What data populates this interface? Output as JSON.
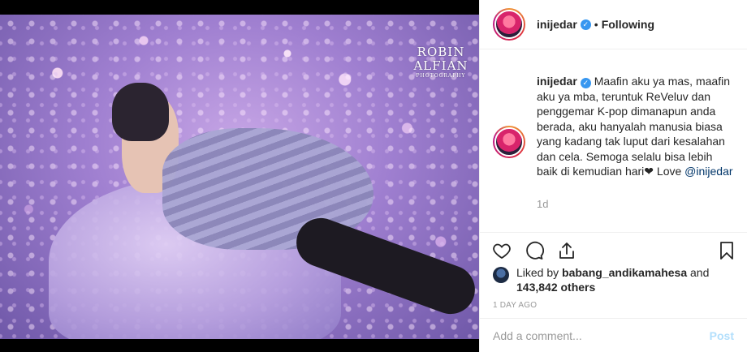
{
  "media": {
    "watermark_line1": "ROBIN",
    "watermark_line2": "ALFIAN",
    "watermark_line3": "PHOTOGRAPHY"
  },
  "header": {
    "username": "inijedar",
    "separator": "•",
    "follow_status": "Following"
  },
  "caption": {
    "username": "inijedar",
    "text": "Maafin aku ya mas, maafin aku ya mba, teruntuk ReVeluv dan penggemar K-pop dimanapun anda berada, aku hanyalah manusia biasa yang kadang tak luput dari kesalahan dan cela. Semoga selalu bisa lebih baik di kemudian hari❤ Love",
    "mention": "@inijedar",
    "time": "1d"
  },
  "actions": {
    "like_icon": "heart-icon",
    "comment_icon": "comment-icon",
    "share_icon": "share-icon",
    "save_icon": "bookmark-icon"
  },
  "likes": {
    "prefix": "Liked by",
    "user": "babang_andikamahesa",
    "and": "and",
    "count": "143,842 others"
  },
  "timestamp": "1 DAY AGO",
  "comment_box": {
    "placeholder": "Add a comment...",
    "post_label": "Post"
  },
  "colors": {
    "link": "#003569",
    "verified": "#3897f0",
    "post_button": "#b2dffc"
  }
}
